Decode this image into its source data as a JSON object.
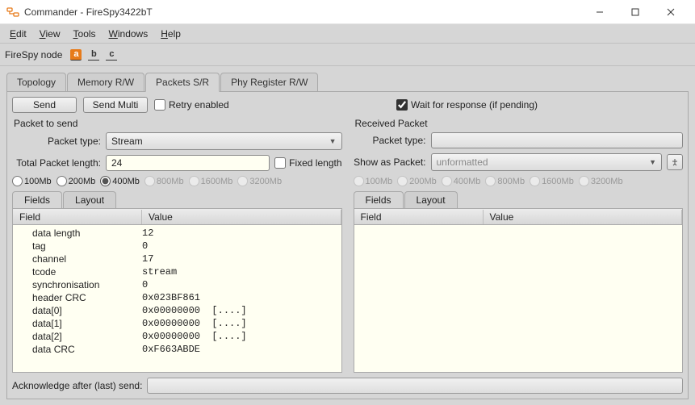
{
  "window": {
    "title": "Commander - FireSpy3422bT"
  },
  "menu": {
    "items": [
      "Edit",
      "View",
      "Tools",
      "Windows",
      "Help"
    ]
  },
  "node": {
    "label": "FireSpy node",
    "options": [
      "a",
      "b",
      "c"
    ],
    "active_index": 0
  },
  "tabs": {
    "items": [
      "Topology",
      "Memory R/W",
      "Packets S/R",
      "Phy Register R/W"
    ],
    "active_index": 2
  },
  "packets_sr": {
    "buttons": {
      "send": "Send",
      "send_multi": "Send Multi"
    },
    "retry_label": "Retry enabled",
    "retry_checked": false,
    "wait_label": "Wait for response (if pending)",
    "wait_checked": true,
    "left": {
      "section_title": "Packet to send",
      "packet_type_label": "Packet type:",
      "packet_type_value": "Stream",
      "total_length_label": "Total Packet length:",
      "total_length_value": "24",
      "fixed_length_label": "Fixed length",
      "fixed_length_checked": false,
      "speeds": [
        "100Mb",
        "200Mb",
        "400Mb",
        "800Mb",
        "1600Mb",
        "3200Mb"
      ],
      "speeds_enabled": [
        true,
        true,
        true,
        false,
        false,
        false
      ],
      "speed_selected_index": 2,
      "subtabs": [
        "Fields",
        "Layout"
      ],
      "subtab_active_index": 0,
      "columns": [
        "Field",
        "Value"
      ],
      "rows": [
        {
          "field": "data length",
          "value": "12"
        },
        {
          "field": "tag",
          "value": "0"
        },
        {
          "field": "channel",
          "value": "17"
        },
        {
          "field": "tcode",
          "value": "stream"
        },
        {
          "field": "synchronisation",
          "value": "0"
        },
        {
          "field": "header CRC",
          "value": "0x023BF861"
        },
        {
          "field": "data[0]",
          "value": "0x00000000  [....]"
        },
        {
          "field": "data[1]",
          "value": "0x00000000  [....]"
        },
        {
          "field": "data[2]",
          "value": "0x00000000  [....]"
        },
        {
          "field": "data CRC",
          "value": "0xF663ABDE"
        }
      ]
    },
    "right": {
      "section_title": "Received Packet",
      "packet_type_label": "Packet type:",
      "packet_type_value": "",
      "show_as_label": "Show as Packet:",
      "show_as_value": "unformatted",
      "speeds": [
        "100Mb",
        "200Mb",
        "400Mb",
        "800Mb",
        "1600Mb",
        "3200Mb"
      ],
      "speeds_enabled": [
        false,
        false,
        false,
        false,
        false,
        false
      ],
      "speed_selected_index": -1,
      "subtabs": [
        "Fields",
        "Layout"
      ],
      "subtab_active_index": 0,
      "columns": [
        "Field",
        "Value"
      ]
    },
    "ack_label": "Acknowledge after (last) send:",
    "ack_value": ""
  }
}
